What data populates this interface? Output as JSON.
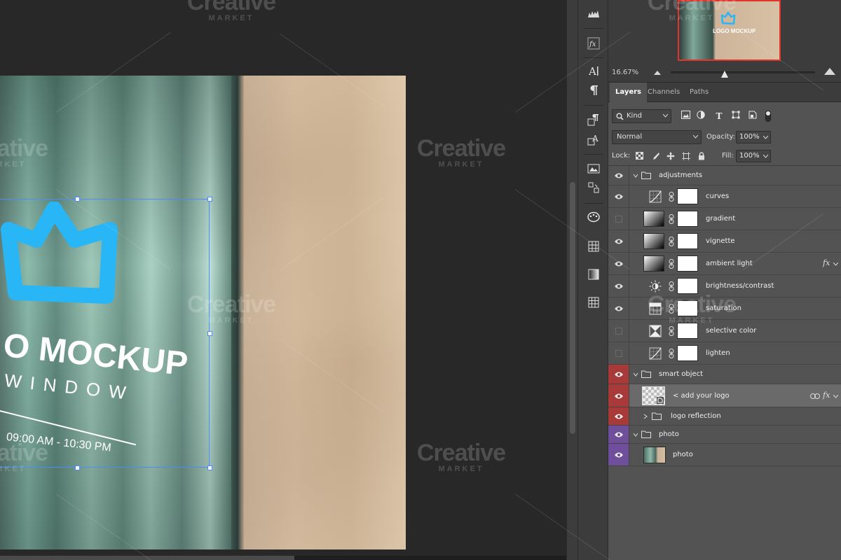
{
  "canvas": {
    "logo_title": "O MOCKUP",
    "logo_subtitle": "WINDOW",
    "logo_hours": "09:00 AM - 10:30 PM"
  },
  "navigator": {
    "thumbnail_text": "LOGO MOCKUP",
    "zoom": "16.67%"
  },
  "panel": {
    "tabs": [
      {
        "label": "Layers",
        "active": true
      },
      {
        "label": "Channels",
        "active": false
      },
      {
        "label": "Paths",
        "active": false
      }
    ],
    "filter_kind": "Kind",
    "blend_mode": "Normal",
    "opacity_label": "Opacity:",
    "opacity_value": "100%",
    "lock_label": "Lock:",
    "fill_label": "Fill:",
    "fill_value": "100%"
  },
  "layers": [
    {
      "name": "adjustments",
      "kind": "group",
      "visible": true,
      "expanded": true
    },
    {
      "name": "curves",
      "kind": "adjustment",
      "icon": "curves-icon",
      "visible": true
    },
    {
      "name": "gradient",
      "kind": "adjustment",
      "icon": "gradient-map-icon",
      "visible": false
    },
    {
      "name": "vignette",
      "kind": "adjustment",
      "icon": "gradient-fill-icon",
      "visible": true
    },
    {
      "name": "ambient light",
      "kind": "adjustment",
      "icon": "gradient-fill-icon",
      "visible": true,
      "fx": "fx"
    },
    {
      "name": "brightness/contrast",
      "kind": "adjustment",
      "icon": "brightness-icon",
      "visible": true
    },
    {
      "name": "saturation",
      "kind": "adjustment",
      "icon": "hue-saturation-icon",
      "visible": true
    },
    {
      "name": "selective color",
      "kind": "adjustment",
      "icon": "selective-color-icon",
      "visible": false
    },
    {
      "name": "lighten",
      "kind": "adjustment",
      "icon": "curves-icon",
      "visible": false
    },
    {
      "name": "smart object",
      "kind": "group",
      "visible": true,
      "expanded": true,
      "label_color": "#a83a3a"
    },
    {
      "name": "< add your logo",
      "kind": "smart-object",
      "visible": true,
      "selected": true,
      "fx": "fx",
      "label_color": "#a83a3a"
    },
    {
      "name": "logo reflection",
      "kind": "group",
      "visible": true,
      "expanded": false,
      "label_color": "#a83a3a"
    },
    {
      "name": "photo",
      "kind": "group",
      "visible": true,
      "expanded": true,
      "label_color": "#6f4f9c"
    },
    {
      "name": "photo",
      "kind": "image",
      "visible": true,
      "label_color": "#6f4f9c"
    }
  ],
  "watermark": {
    "big": "Creative",
    "small": "MARKET"
  },
  "colors": {
    "accent_selection": "#4a8cff",
    "logo_blue": "#29b6f6",
    "red_label": "#a83a3a",
    "violet_label": "#6f4f9c"
  }
}
